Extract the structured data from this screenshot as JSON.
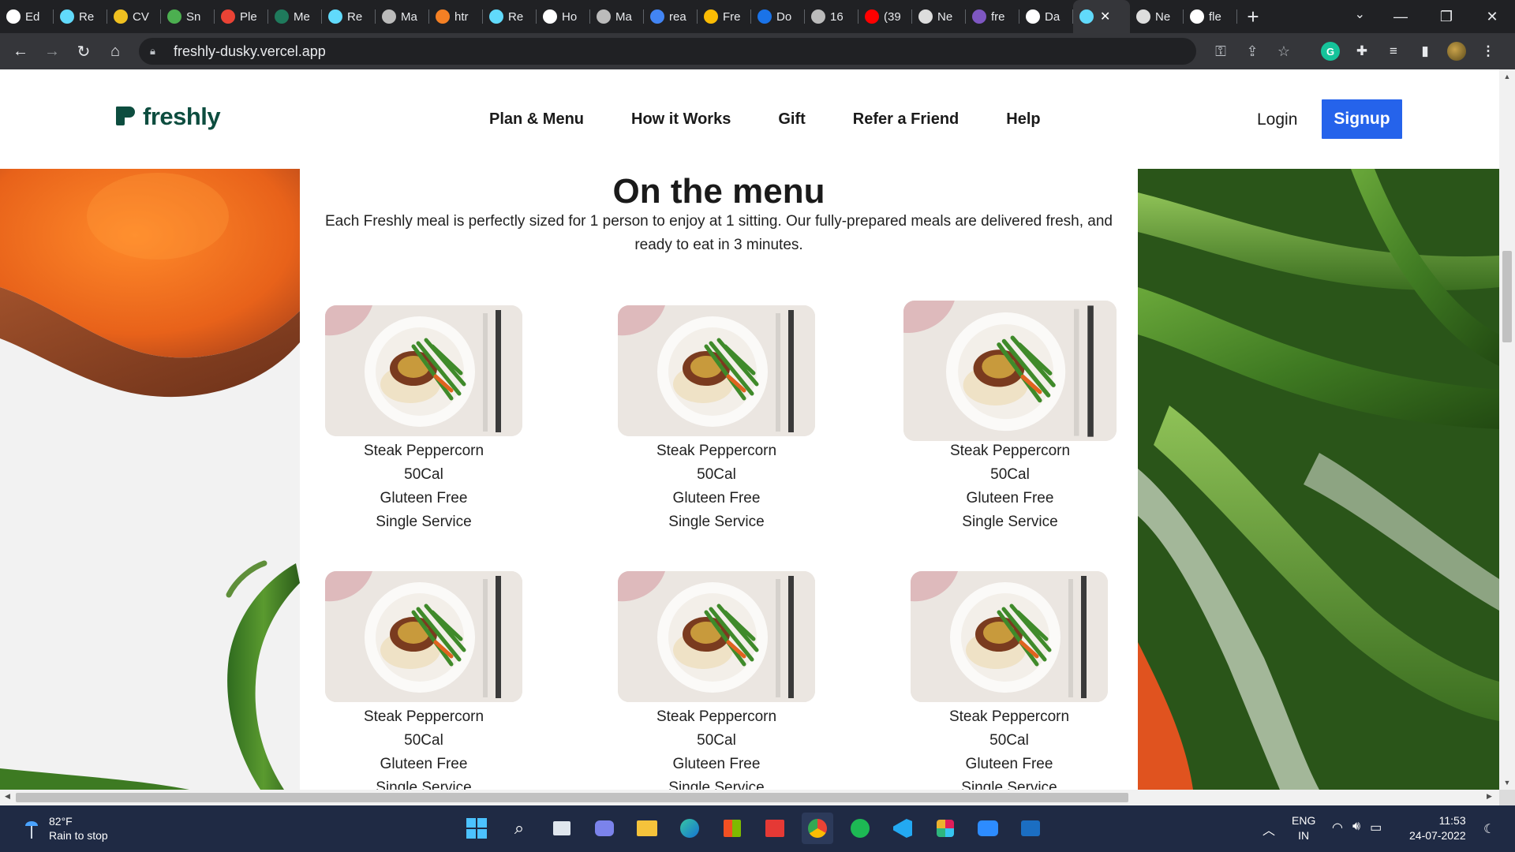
{
  "browser": {
    "tabs": [
      {
        "title": "Ed",
        "icon": "github-icon",
        "color": "#ffffff"
      },
      {
        "title": "Re",
        "icon": "react-icon",
        "color": "#61dafb"
      },
      {
        "title": "CV",
        "icon": "hourglass-icon",
        "color": "#f0c020"
      },
      {
        "title": "Sn",
        "icon": "snapshot-icon",
        "color": "#4caf50"
      },
      {
        "title": "Ple",
        "icon": "gmail-icon",
        "color": "#ea4335"
      },
      {
        "title": "Me",
        "icon": "freshly-icon",
        "color": "#1f7a5c"
      },
      {
        "title": "Re",
        "icon": "react-icon",
        "color": "#61dafb"
      },
      {
        "title": "Ma",
        "icon": "globe-icon",
        "color": "#bbbbbb"
      },
      {
        "title": "htr",
        "icon": "stackoverflow-icon",
        "color": "#f48024"
      },
      {
        "title": "Re",
        "icon": "react-icon",
        "color": "#61dafb"
      },
      {
        "title": "Ho",
        "icon": "medium-icon",
        "color": "#ffffff"
      },
      {
        "title": "Ma",
        "icon": "globe-icon",
        "color": "#bbbbbb"
      },
      {
        "title": "rea",
        "icon": "google-icon",
        "color": "#4285f4"
      },
      {
        "title": "Fre",
        "icon": "drive-icon",
        "color": "#fbbc04"
      },
      {
        "title": "Do",
        "icon": "download-icon",
        "color": "#1a73e8"
      },
      {
        "title": "16",
        "icon": "globe-icon",
        "color": "#bbbbbb"
      },
      {
        "title": "(39",
        "icon": "youtube-icon",
        "color": "#ff0000"
      },
      {
        "title": "Ne",
        "icon": "chrome-icon",
        "color": "#dddddd"
      },
      {
        "title": "fre",
        "icon": "heroku-icon",
        "color": "#7e57c2"
      },
      {
        "title": "Da",
        "icon": "vercel-icon",
        "color": "#ffffff"
      }
    ],
    "active_tab": {
      "icon": "react-icon",
      "color": "#61dafb"
    },
    "after_tabs": [
      {
        "title": "Ne",
        "icon": "chrome-icon",
        "color": "#dddddd"
      },
      {
        "title": "fle",
        "icon": "github-icon",
        "color": "#ffffff"
      }
    ],
    "url": "freshly-dusky.vercel.app"
  },
  "site": {
    "brand": "freshly",
    "nav": [
      "Plan & Menu",
      "How it Works",
      "Gift",
      "Refer a Friend",
      "Help"
    ],
    "login": "Login",
    "signup": "Signup",
    "accent": "#2563eb",
    "brand_color": "#0d4d3f"
  },
  "menu": {
    "title": "On the menu",
    "intro": "Each Freshly meal is perfectly sized for 1 person to enjoy at 1 sitting. Our fully-prepared meals are delivered fresh, and ready to eat in 3 minutes.",
    "cards": [
      {
        "name": "Steak Peppercorn",
        "cal": "50Cal",
        "diet": "Gluteen Free",
        "serving": "Single Service"
      },
      {
        "name": "Steak Peppercorn",
        "cal": "50Cal",
        "diet": "Gluteen Free",
        "serving": "Single Service"
      },
      {
        "name": "Steak Peppercorn",
        "cal": "50Cal",
        "diet": "Gluteen Free",
        "serving": "Single Service"
      },
      {
        "name": "Steak Peppercorn",
        "cal": "50Cal",
        "diet": "Gluteen Free",
        "serving": "Single Service"
      },
      {
        "name": "Steak Peppercorn",
        "cal": "50Cal",
        "diet": "Gluteen Free",
        "serving": "Single Service"
      },
      {
        "name": "Steak Peppercorn",
        "cal": "50Cal",
        "diet": "Gluteen Free",
        "serving": "Single Service"
      }
    ]
  },
  "taskbar": {
    "weather_temp": "82°F",
    "weather_desc": "Rain to stop",
    "lang": "ENG",
    "region": "IN",
    "time": "11:53",
    "date": "24-07-2022"
  }
}
